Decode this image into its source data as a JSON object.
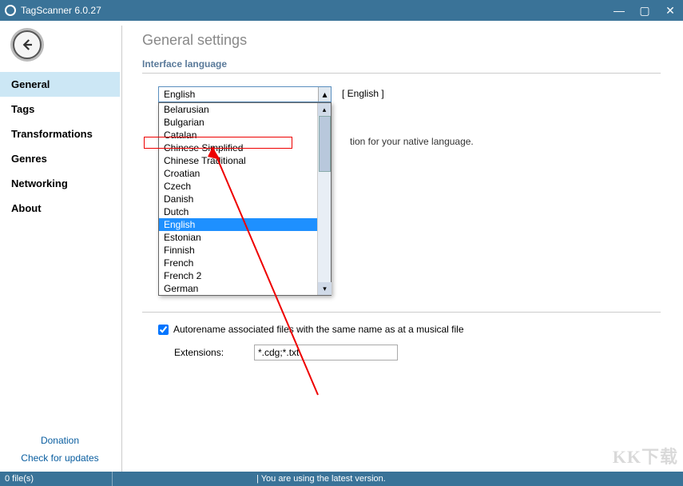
{
  "window": {
    "title": "TagScanner 6.0.27"
  },
  "win_btns": {
    "min": "—",
    "max": "▢",
    "close": "✕"
  },
  "nav": {
    "items": [
      {
        "label": "General",
        "active": true
      },
      {
        "label": "Tags"
      },
      {
        "label": "Transformations"
      },
      {
        "label": "Genres"
      },
      {
        "label": "Networking"
      },
      {
        "label": "About"
      }
    ],
    "bottom": {
      "donation": "Donation",
      "updates": "Check for updates"
    }
  },
  "content": {
    "heading": "General settings",
    "section_label": "Interface language",
    "combo_value": "English",
    "combo_right": "[ English ]",
    "options": [
      "Belarusian",
      "Bulgarian",
      "Catalan",
      "Chinese Simplified",
      "Chinese Traditional",
      "Croatian",
      "Czech",
      "Danish",
      "Dutch",
      "English",
      "Estonian",
      "Finnish",
      "French",
      "French 2",
      "German"
    ],
    "selected_option": "English",
    "partial_text": "tion for your native language.",
    "checkbox_label": "Autorename associated files with the same name as at a musical file",
    "ext_label": "Extensions:",
    "ext_value": "*.cdg;*.txt"
  },
  "status": {
    "files": "0 file(s)",
    "version": "| You are using the latest version."
  },
  "watermark": "KK下载"
}
